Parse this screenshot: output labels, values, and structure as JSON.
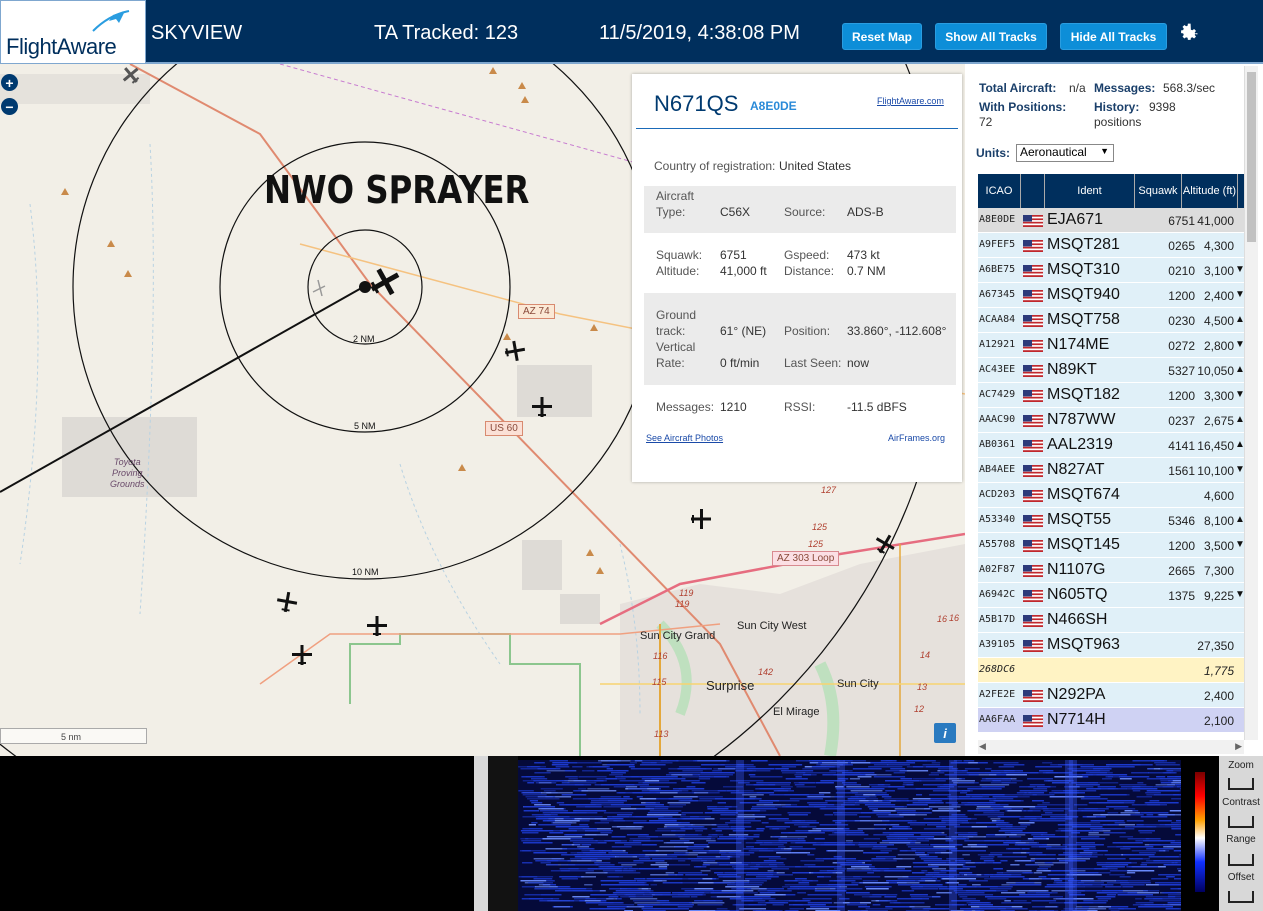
{
  "header": {
    "logo_text": "FlightAware",
    "app_title": "SKYVIEW",
    "tracked_label": "TA Tracked: 123",
    "datetime": "11/5/2019, 4:38:08 PM",
    "buttons": [
      "Reset Map",
      "Show All Tracks",
      "Hide All Tracks"
    ],
    "settings_icon": "gear-icon",
    "brand_color": "#002f5d",
    "button_color": "#0d8ed8"
  },
  "map": {
    "zoom_in": "+",
    "zoom_out": "−",
    "annotation": "NWO SPRAYER",
    "range_labels": [
      "2 NM",
      "5 NM",
      "10 NM"
    ],
    "road_labels": [
      "AZ 74",
      "US 60",
      "AZ 303 Loop"
    ],
    "place_labels": [
      "Toyota",
      "Proving",
      "Grounds",
      "Sun City Grand",
      "Sun City West",
      "Surprise",
      "Sun City",
      "El Mirage"
    ],
    "road_numbers": [
      "127",
      "125",
      "125",
      "119",
      "119",
      "116",
      "115",
      "113",
      "142",
      "16",
      "16",
      "14",
      "13",
      "12"
    ],
    "scale_label": "5 nm",
    "info_icon": "i"
  },
  "selected": {
    "callsign": "N671QS",
    "icao": "A8E0DE",
    "fa_link": "FlightAware.com",
    "country_label": "Country of registration:",
    "country": "United States",
    "aircraft_type_label1": "Aircraft",
    "aircraft_type_label2": "Type:",
    "aircraft_type": "C56X",
    "source_label": "Source:",
    "source": "ADS-B",
    "squawk_label": "Squawk:",
    "squawk": "6751",
    "gspeed_label": "Gspeed:",
    "gspeed": "473 kt",
    "altitude_label": "Altitude:",
    "altitude": "41,000 ft",
    "distance_label": "Distance:",
    "distance": "0.7 NM",
    "track_label1": "Ground",
    "track_label2": "track:",
    "track": "61° (NE)",
    "position_label": "Position:",
    "position": "33.860°, -112.608°",
    "vrate_label1": "Vertical",
    "vrate_label2": "Rate:",
    "vrate": "0 ft/min",
    "lastseen_label": "Last Seen:",
    "lastseen": "now",
    "messages_label": "Messages:",
    "messages": "1210",
    "rssi_label": "RSSI:",
    "rssi": "-11.5 dBFS",
    "photos_link": "See Aircraft Photos",
    "airframes_link": "AirFrames.org"
  },
  "sidebar": {
    "total_label": "Total Aircraft:",
    "total_value": "n/a",
    "messages_label": "Messages:",
    "messages_value": "568.3/sec",
    "positions_label": "With Positions:",
    "positions_value": "72",
    "history_label": "History:",
    "history_value": "9398",
    "history_unit": "positions",
    "units_label": "Units:",
    "units_value": "Aeronautical",
    "columns": [
      "ICAO",
      "",
      "Ident",
      "Squawk",
      "Altitude (ft)"
    ],
    "rows": [
      {
        "icao": "A8E0DE",
        "ident": "EJA671",
        "squawk": "6751",
        "alt": "41,000",
        "trend": "",
        "flag": true,
        "style": "sel"
      },
      {
        "icao": "A9FEF5",
        "ident": "MSQT281",
        "squawk": "0265",
        "alt": "4,300",
        "trend": "",
        "flag": true,
        "style": ""
      },
      {
        "icao": "A6BE75",
        "ident": "MSQT310",
        "squawk": "0210",
        "alt": "3,100",
        "trend": "▼",
        "flag": true,
        "style": ""
      },
      {
        "icao": "A67345",
        "ident": "MSQT940",
        "squawk": "1200",
        "alt": "2,400",
        "trend": "▼",
        "flag": true,
        "style": ""
      },
      {
        "icao": "ACAA84",
        "ident": "MSQT758",
        "squawk": "0230",
        "alt": "4,500",
        "trend": "▲",
        "flag": true,
        "style": ""
      },
      {
        "icao": "A12921",
        "ident": "N174ME",
        "squawk": "0272",
        "alt": "2,800",
        "trend": "▼",
        "flag": true,
        "style": ""
      },
      {
        "icao": "AC43EE",
        "ident": "N89KT",
        "squawk": "5327",
        "alt": "10,050",
        "trend": "▲",
        "flag": true,
        "style": ""
      },
      {
        "icao": "AC7429",
        "ident": "MSQT182",
        "squawk": "1200",
        "alt": "3,300",
        "trend": "▼",
        "flag": true,
        "style": ""
      },
      {
        "icao": "AAAC90",
        "ident": "N787WW",
        "squawk": "0237",
        "alt": "2,675",
        "trend": "▲",
        "flag": true,
        "style": ""
      },
      {
        "icao": "AB0361",
        "ident": "AAL2319",
        "squawk": "4141",
        "alt": "16,450",
        "trend": "▲",
        "flag": true,
        "style": ""
      },
      {
        "icao": "AB4AEE",
        "ident": "N827AT",
        "squawk": "1561",
        "alt": "10,100",
        "trend": "▼",
        "flag": true,
        "style": ""
      },
      {
        "icao": "ACD203",
        "ident": "MSQT674",
        "squawk": "",
        "alt": "4,600",
        "trend": "",
        "flag": true,
        "style": ""
      },
      {
        "icao": "A53340",
        "ident": "MSQT55",
        "squawk": "5346",
        "alt": "8,100",
        "trend": "▲",
        "flag": true,
        "style": ""
      },
      {
        "icao": "A55708",
        "ident": "MSQT145",
        "squawk": "1200",
        "alt": "3,500",
        "trend": "▼",
        "flag": true,
        "style": ""
      },
      {
        "icao": "A02F87",
        "ident": "N1107G",
        "squawk": "2665",
        "alt": "7,300",
        "trend": "",
        "flag": true,
        "style": ""
      },
      {
        "icao": "A6942C",
        "ident": "N605TQ",
        "squawk": "1375",
        "alt": "9,225",
        "trend": "▼",
        "flag": true,
        "style": ""
      },
      {
        "icao": "A5B17D",
        "ident": "N466SH",
        "squawk": "",
        "alt": "",
        "trend": "",
        "flag": true,
        "style": ""
      },
      {
        "icao": "A39105",
        "ident": "MSQT963",
        "squawk": "",
        "alt": "27,350",
        "trend": "",
        "flag": true,
        "style": ""
      },
      {
        "icao": "268DC6",
        "ident": "",
        "squawk": "",
        "alt": "1,775",
        "trend": "",
        "flag": false,
        "style": "mlat"
      },
      {
        "icao": "A2FE2E",
        "ident": "N292PA",
        "squawk": "",
        "alt": "2,400",
        "trend": "",
        "flag": true,
        "style": ""
      },
      {
        "icao": "AA6FAA",
        "ident": "N7714H",
        "squawk": "",
        "alt": "2,100",
        "trend": "",
        "flag": true,
        "style": "lav"
      }
    ]
  },
  "spectrum": {
    "controls": [
      "Zoom",
      "Contrast",
      "Range",
      "Offset"
    ]
  }
}
